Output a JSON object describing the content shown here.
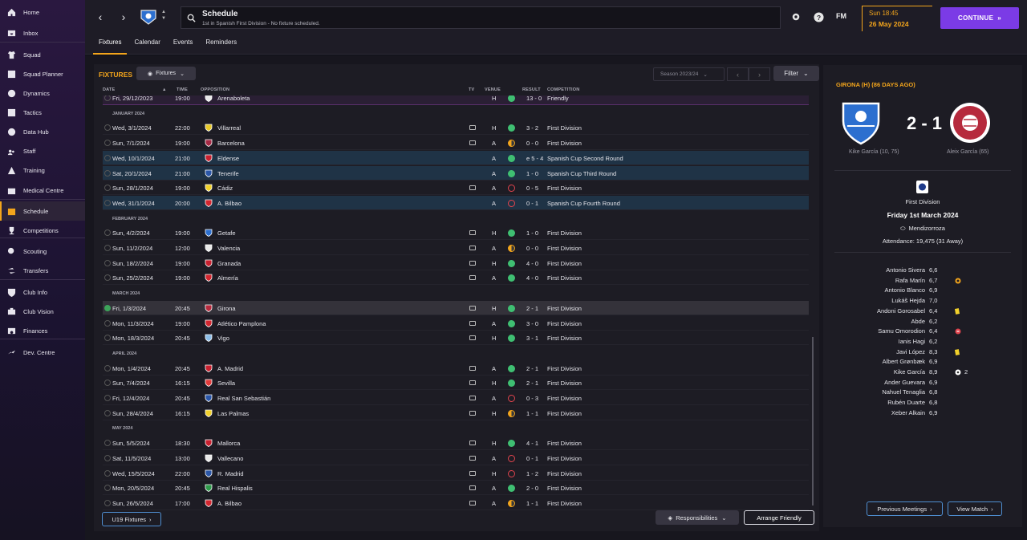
{
  "sidebar": {
    "items": [
      {
        "label": "Home",
        "icon": "home-icon"
      },
      {
        "label": "Inbox",
        "icon": "inbox-icon"
      },
      {
        "label": "Squad",
        "icon": "shirt-icon"
      },
      {
        "label": "Squad Planner",
        "icon": "planner-icon"
      },
      {
        "label": "Dynamics",
        "icon": "dynamics-icon"
      },
      {
        "label": "Tactics",
        "icon": "tactics-icon"
      },
      {
        "label": "Data Hub",
        "icon": "data-hub-icon"
      },
      {
        "label": "Staff",
        "icon": "staff-icon"
      },
      {
        "label": "Training",
        "icon": "training-icon"
      },
      {
        "label": "Medical Centre",
        "icon": "medical-icon"
      },
      {
        "label": "Schedule",
        "icon": "calendar-icon"
      },
      {
        "label": "Competitions",
        "icon": "trophy-icon"
      },
      {
        "label": "Scouting",
        "icon": "scouting-icon"
      },
      {
        "label": "Transfers",
        "icon": "transfers-icon"
      },
      {
        "label": "Club Info",
        "icon": "shield-icon"
      },
      {
        "label": "Club Vision",
        "icon": "vision-icon"
      },
      {
        "label": "Finances",
        "icon": "finances-icon"
      },
      {
        "label": "Dev. Centre",
        "icon": "dev-centre-icon"
      }
    ],
    "active": "Schedule"
  },
  "header": {
    "title": "Schedule",
    "subtitle": "1st in Spanish First Division - No fixture scheduled.",
    "fm_logo": "FM",
    "time": "Sun 18:45",
    "date": "26 May 2024",
    "continue_label": "CONTINUE",
    "tabs": [
      "Fixtures",
      "Calendar",
      "Events",
      "Reminders"
    ]
  },
  "fixtures": {
    "title": "FIXTURES",
    "view_dropdown": "Fixtures",
    "season": "Season 2023/24",
    "filter_label": "Filter",
    "columns": {
      "date": "DATE",
      "time": "TIME",
      "opposition": "OPPOSITION",
      "tv": "TV",
      "venue": "VENUE",
      "result": "RESULT",
      "competition": "COMPETITION"
    },
    "partial_row": {
      "date": "Fri, 29/12/2023",
      "time": "19:00",
      "opp": "Arenaboleta",
      "venue": "H",
      "result": "13 - 0",
      "comp": "Friendly"
    },
    "groups": [
      {
        "month": "JANUARY 2024",
        "rows": [
          {
            "date": "Wed, 3/1/2024",
            "time": "22:00",
            "opp": "Villarreal",
            "tv": true,
            "venue": "H",
            "outcome": "w",
            "result": "3 - 2",
            "comp": "First Division",
            "style": "",
            "crest_color": "#e8c92a"
          },
          {
            "date": "Sun, 7/1/2024",
            "time": "19:00",
            "opp": "Barcelona",
            "tv": true,
            "venue": "A",
            "outcome": "d",
            "result": "0 - 0",
            "comp": "First Division",
            "style": "",
            "crest_color": "#a52944"
          },
          {
            "date": "Wed, 10/1/2024",
            "time": "21:00",
            "opp": "Eldense",
            "tv": false,
            "venue": "A",
            "outcome": "w",
            "result": "e 5 - 4",
            "comp": "Spanish Cup Second Round",
            "style": "cup",
            "crest_color": "#c8202f"
          },
          {
            "date": "Sat, 20/1/2024",
            "time": "21:00",
            "opp": "Tenerife",
            "tv": false,
            "venue": "A",
            "outcome": "w",
            "result": "1 - 0",
            "comp": "Spanish Cup Third Round",
            "style": "cup",
            "crest_color": "#2a56a8"
          },
          {
            "date": "Sun, 28/1/2024",
            "time": "19:00",
            "opp": "Cádiz",
            "tv": true,
            "venue": "A",
            "outcome": "l",
            "result": "0 - 5",
            "comp": "First Division",
            "style": "",
            "crest_color": "#f2d12b"
          },
          {
            "date": "Wed, 31/1/2024",
            "time": "20:00",
            "opp": "A. Bilbao",
            "tv": false,
            "venue": "A",
            "outcome": "l",
            "result": "0 - 1",
            "comp": "Spanish Cup Fourth Round",
            "style": "cup",
            "crest_color": "#d3262f"
          }
        ]
      },
      {
        "month": "FEBRUARY 2024",
        "rows": [
          {
            "date": "Sun, 4/2/2024",
            "time": "19:00",
            "opp": "Getafe",
            "tv": true,
            "venue": "H",
            "outcome": "w",
            "result": "1 - 0",
            "comp": "First Division",
            "style": "",
            "crest_color": "#2c6fcf"
          },
          {
            "date": "Sun, 11/2/2024",
            "time": "12:00",
            "opp": "Valencia",
            "tv": true,
            "venue": "A",
            "outcome": "d",
            "result": "0 - 0",
            "comp": "First Division",
            "style": "",
            "crest_color": "#e9e9e9"
          },
          {
            "date": "Sun, 18/2/2024",
            "time": "19:00",
            "opp": "Granada",
            "tv": true,
            "venue": "H",
            "outcome": "w",
            "result": "4 - 0",
            "comp": "First Division",
            "style": "",
            "crest_color": "#c8202f"
          },
          {
            "date": "Sun, 25/2/2024",
            "time": "19:00",
            "opp": "Almería",
            "tv": true,
            "venue": "A",
            "outcome": "w",
            "result": "4 - 0",
            "comp": "First Division",
            "style": "",
            "crest_color": "#d3262f"
          }
        ]
      },
      {
        "month": "MARCH 2024",
        "rows": [
          {
            "date": "Fri, 1/3/2024",
            "time": "20:45",
            "opp": "Girona",
            "tv": true,
            "venue": "H",
            "outcome": "w",
            "result": "2 - 1",
            "comp": "First Division",
            "style": "sel",
            "crest_color": "#b62a3d",
            "check": true
          },
          {
            "date": "Mon, 11/3/2024",
            "time": "19:00",
            "opp": "Atlético Pamplona",
            "tv": true,
            "venue": "A",
            "outcome": "w",
            "result": "3 - 0",
            "comp": "First Division",
            "style": "",
            "crest_color": "#d3262f"
          },
          {
            "date": "Mon, 18/3/2024",
            "time": "20:45",
            "opp": "Vigo",
            "tv": true,
            "venue": "H",
            "outcome": "w",
            "result": "3 - 1",
            "comp": "First Division",
            "style": "",
            "crest_color": "#8bbde8"
          }
        ]
      },
      {
        "month": "APRIL 2024",
        "rows": [
          {
            "date": "Mon, 1/4/2024",
            "time": "20:45",
            "opp": "A. Madrid",
            "tv": true,
            "venue": "A",
            "outcome": "w",
            "result": "2 - 1",
            "comp": "First Division",
            "style": "",
            "crest_color": "#c8202f"
          },
          {
            "date": "Sun, 7/4/2024",
            "time": "16:15",
            "opp": "Sevilla",
            "tv": true,
            "venue": "H",
            "outcome": "w",
            "result": "2 - 1",
            "comp": "First Division",
            "style": "",
            "crest_color": "#e33b3b"
          },
          {
            "date": "Fri, 12/4/2024",
            "time": "20:45",
            "opp": "Real San Sebastián",
            "tv": true,
            "venue": "A",
            "outcome": "l",
            "result": "0 - 3",
            "comp": "First Division",
            "style": "",
            "crest_color": "#2a56a8"
          },
          {
            "date": "Sun, 28/4/2024",
            "time": "16:15",
            "opp": "Las Palmas",
            "tv": true,
            "venue": "H",
            "outcome": "d",
            "result": "1 - 1",
            "comp": "First Division",
            "style": "",
            "crest_color": "#f2d12b"
          }
        ]
      },
      {
        "month": "MAY 2024",
        "rows": [
          {
            "date": "Sun, 5/5/2024",
            "time": "18:30",
            "opp": "Mallorca",
            "tv": true,
            "venue": "H",
            "outcome": "w",
            "result": "4 - 1",
            "comp": "First Division",
            "style": "",
            "crest_color": "#c8202f"
          },
          {
            "date": "Sat, 11/5/2024",
            "time": "13:00",
            "opp": "Vallecano",
            "tv": true,
            "venue": "A",
            "outcome": "l",
            "result": "0 - 1",
            "comp": "First Division",
            "style": "",
            "crest_color": "#e9e9e9"
          },
          {
            "date": "Wed, 15/5/2024",
            "time": "22:00",
            "opp": "R. Madrid",
            "tv": true,
            "venue": "H",
            "outcome": "l",
            "result": "1 - 2",
            "comp": "First Division",
            "style": "",
            "crest_color": "#2a56a8"
          },
          {
            "date": "Mon, 20/5/2024",
            "time": "20:45",
            "opp": "Real Hispalis",
            "tv": true,
            "venue": "A",
            "outcome": "w",
            "result": "2 - 0",
            "comp": "First Division",
            "style": "",
            "crest_color": "#2e9a4b"
          },
          {
            "date": "Sun, 26/5/2024",
            "time": "17:00",
            "opp": "A. Bilbao",
            "tv": true,
            "venue": "A",
            "outcome": "d",
            "result": "1 - 1",
            "comp": "First Division",
            "style": "",
            "crest_color": "#d3262f"
          }
        ]
      }
    ],
    "u19_label": "U19 Fixtures",
    "responsibilities_label": "Responsibilities",
    "arrange_label": "Arrange Friendly"
  },
  "match": {
    "title": "GIRONA (H) (86 DAYS AGO)",
    "score": "2 - 1",
    "home_scorer": "Kike García (10, 75)",
    "away_scorer": "Aleix García (65)",
    "competition": "First Division",
    "date": "Friday 1st March 2024",
    "stadium": "Mendizorroza",
    "attendance": "Attendance: 19,475 (31 Away)",
    "players": [
      {
        "name": "Antonio Sivera",
        "rating": "6,6",
        "icon": ""
      },
      {
        "name": "Rafa Marín",
        "rating": "6,7",
        "icon": "sub-icon"
      },
      {
        "name": "Antonio Blanco",
        "rating": "6,9",
        "icon": ""
      },
      {
        "name": "Lukáš Hejda",
        "rating": "7,0",
        "icon": ""
      },
      {
        "name": "Andoni Gorosabel",
        "rating": "6,4",
        "icon": "yellow-card-icon"
      },
      {
        "name": "Abde",
        "rating": "6,2",
        "icon": ""
      },
      {
        "name": "Samu Omorodion",
        "rating": "6,4",
        "icon": "injury-icon"
      },
      {
        "name": "Ianis Hagi",
        "rating": "6,2",
        "icon": ""
      },
      {
        "name": "Javi López",
        "rating": "8,3",
        "icon": "yellow-card-icon"
      },
      {
        "name": "Albert Grønbæk",
        "rating": "6,9",
        "icon": ""
      },
      {
        "name": "Kike García",
        "rating": "8,9",
        "icon": "goal-icon",
        "goals": "2"
      },
      {
        "name": "Ander Guevara",
        "rating": "6,9",
        "icon": ""
      },
      {
        "name": "Nahuel Tenaglia",
        "rating": "6,8",
        "icon": ""
      },
      {
        "name": "Rubén Duarte",
        "rating": "6,8",
        "icon": ""
      },
      {
        "name": "Xeber Alkain",
        "rating": "6,9",
        "icon": ""
      }
    ],
    "prev_meetings_label": "Previous Meetings",
    "view_match_label": "View Match"
  }
}
